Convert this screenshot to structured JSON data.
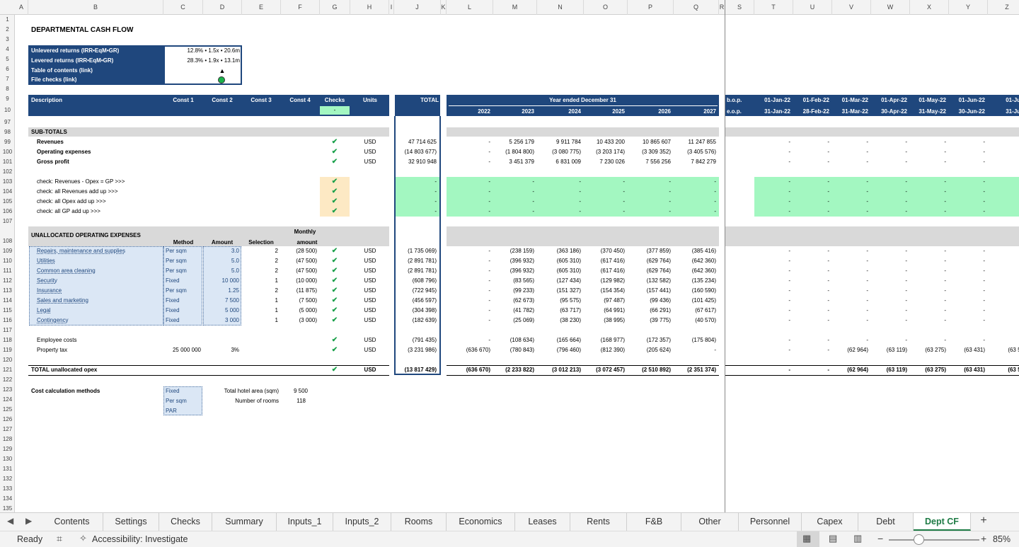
{
  "sheet_title": "DEPARTMENTAL CASH FLOW",
  "columns": [
    "A",
    "B",
    "C",
    "D",
    "E",
    "F",
    "G",
    "H",
    "I",
    "J",
    "K",
    "L",
    "M",
    "N",
    "O",
    "P",
    "Q",
    "R",
    "S",
    "T",
    "U",
    "V",
    "W",
    "X",
    "Y",
    "Z"
  ],
  "row_numbers": [
    "1",
    "2",
    "3",
    "4",
    "5",
    "6",
    "7",
    "8",
    "9",
    "10",
    "97",
    "98",
    "99",
    "100",
    "101",
    "102",
    "103",
    "104",
    "105",
    "106",
    "107",
    "108",
    "109",
    "110",
    "111",
    "112",
    "113",
    "114",
    "115",
    "116",
    "117",
    "118",
    "119",
    "120",
    "121",
    "122",
    "123",
    "124",
    "125",
    "126",
    "127",
    "128",
    "129",
    "130",
    "131",
    "132",
    "133",
    "134",
    "135"
  ],
  "summary_box": {
    "rows": [
      {
        "label": "Unlevered returns (IRR•EqM•GR)",
        "value": "12.8% • 1.5x • 20.6m"
      },
      {
        "label": "Levered returns (IRR•EqM•GR)",
        "value": "28.3% • 1.9x • 13.1m"
      },
      {
        "label": "Table of contents (link)",
        "value": "▲"
      },
      {
        "label": "File checks (link)",
        "value": ""
      }
    ],
    "status_color": "#1bb24b"
  },
  "header": {
    "description": "Description",
    "const1": "Const 1",
    "const2": "Const 2",
    "const3": "Const 3",
    "const4": "Const 4",
    "checks": "Checks",
    "checks_value": "-",
    "units": "Units",
    "total": "TOTAL",
    "year_title": "Year ended December 31",
    "years": [
      "2022",
      "2023",
      "2024",
      "2025",
      "2026",
      "2027"
    ],
    "bop": "b.o.p.",
    "eop": "e.o.p.",
    "month_starts": [
      "01-Jan-22",
      "01-Feb-22",
      "01-Mar-22",
      "01-Apr-22",
      "01-May-22",
      "01-Jun-22",
      "01-Jul-"
    ],
    "month_ends": [
      "31-Jan-22",
      "28-Feb-22",
      "31-Mar-22",
      "30-Apr-22",
      "31-May-22",
      "30-Jun-22",
      "31-Jul-"
    ]
  },
  "subtotals": {
    "title": "SUB-TOTALS",
    "rows": [
      {
        "label": "Revenues",
        "check": "✔",
        "unit": "USD",
        "total": "47 714 625",
        "years": [
          "-",
          "5 256 179",
          "9 911 784",
          "10 433 200",
          "10 865 607",
          "11 247 855"
        ],
        "months": [
          "-",
          "-",
          "-",
          "-",
          "-",
          "-"
        ]
      },
      {
        "label": "Operating expenses",
        "check": "✔",
        "unit": "USD",
        "total": "(14 803 677)",
        "years": [
          "-",
          "(1 804 800)",
          "(3 080 775)",
          "(3 203 174)",
          "(3 309 352)",
          "(3 405 576)"
        ],
        "months": [
          "-",
          "-",
          "-",
          "-",
          "-",
          "-"
        ]
      },
      {
        "label": "Gross profit",
        "check": "✔",
        "unit": "USD",
        "total": "32 910 948",
        "years": [
          "-",
          "3 451 379",
          "6 831 009",
          "7 230 026",
          "7 556 256",
          "7 842 279"
        ],
        "months": [
          "-",
          "-",
          "-",
          "-",
          "-",
          "-"
        ]
      }
    ]
  },
  "checks_rows": [
    {
      "label": "check: Revenues - Opex = GP >>>",
      "check": "✔"
    },
    {
      "label": "check: all Revenues add up >>>",
      "check": "✔"
    },
    {
      "label": "check: all Opex add up >>>",
      "check": "✔"
    },
    {
      "label": "check: all GP add up >>>",
      "check": "✔"
    }
  ],
  "checks_dash": "-",
  "unallocated": {
    "title": "UNALLOCATED OPERATING EXPENSES",
    "method_h": "Method",
    "amount_h": "Amount",
    "selection_h": "Selection",
    "monthly_h1": "Monthly",
    "monthly_h2": "amount",
    "rows": [
      {
        "label": "Repairs, maintenance and supplies",
        "method": "Per sqm",
        "amount": "3.0",
        "selection": "2",
        "monthly": "(28 500)",
        "check": "✔",
        "unit": "USD",
        "total": "(1 735 069)",
        "years": [
          "-",
          "(238 159)",
          "(363 186)",
          "(370 450)",
          "(377 859)",
          "(385 416)"
        ],
        "months": [
          "-",
          "-",
          "-",
          "-",
          "-",
          "-"
        ]
      },
      {
        "label": "Utilities",
        "method": "Per sqm",
        "amount": "5.0",
        "selection": "2",
        "monthly": "(47 500)",
        "check": "✔",
        "unit": "USD",
        "total": "(2 891 781)",
        "years": [
          "-",
          "(396 932)",
          "(605 310)",
          "(617 416)",
          "(629 764)",
          "(642 360)"
        ],
        "months": [
          "-",
          "-",
          "-",
          "-",
          "-",
          "-"
        ]
      },
      {
        "label": "Common area cleaning",
        "method": "Per sqm",
        "amount": "5.0",
        "selection": "2",
        "monthly": "(47 500)",
        "check": "✔",
        "unit": "USD",
        "total": "(2 891 781)",
        "years": [
          "-",
          "(396 932)",
          "(605 310)",
          "(617 416)",
          "(629 764)",
          "(642 360)"
        ],
        "months": [
          "-",
          "-",
          "-",
          "-",
          "-",
          "-"
        ]
      },
      {
        "label": "Security",
        "method": "Fixed",
        "amount": "10 000",
        "selection": "1",
        "monthly": "(10 000)",
        "check": "✔",
        "unit": "USD",
        "total": "(608 796)",
        "years": [
          "-",
          "(83 565)",
          "(127 434)",
          "(129 982)",
          "(132 582)",
          "(135 234)"
        ],
        "months": [
          "-",
          "-",
          "-",
          "-",
          "-",
          "-"
        ]
      },
      {
        "label": "Insurance",
        "method": "Per sqm",
        "amount": "1.25",
        "selection": "2",
        "monthly": "(11 875)",
        "check": "✔",
        "unit": "USD",
        "total": "(722 945)",
        "years": [
          "-",
          "(99 233)",
          "(151 327)",
          "(154 354)",
          "(157 441)",
          "(160 590)"
        ],
        "months": [
          "-",
          "-",
          "-",
          "-",
          "-",
          "-"
        ]
      },
      {
        "label": "Sales and marketing",
        "method": "Fixed",
        "amount": "7 500",
        "selection": "1",
        "monthly": "(7 500)",
        "check": "✔",
        "unit": "USD",
        "total": "(456 597)",
        "years": [
          "-",
          "(62 673)",
          "(95 575)",
          "(97 487)",
          "(99 436)",
          "(101 425)"
        ],
        "months": [
          "-",
          "-",
          "-",
          "-",
          "-",
          "-"
        ]
      },
      {
        "label": "Legal",
        "method": "Fixed",
        "amount": "5 000",
        "selection": "1",
        "monthly": "(5 000)",
        "check": "✔",
        "unit": "USD",
        "total": "(304 398)",
        "years": [
          "-",
          "(41 782)",
          "(63 717)",
          "(64 991)",
          "(66 291)",
          "(67 617)"
        ],
        "months": [
          "-",
          "-",
          "-",
          "-",
          "-",
          "-"
        ]
      },
      {
        "label": "Contingency",
        "method": "Fixed",
        "amount": "3 000",
        "selection": "1",
        "monthly": "(3 000)",
        "check": "✔",
        "unit": "USD",
        "total": "(182 639)",
        "years": [
          "-",
          "(25 069)",
          "(38 230)",
          "(38 995)",
          "(39 775)",
          "(40 570)"
        ],
        "months": [
          "-",
          "-",
          "-",
          "-",
          "-",
          "-"
        ]
      }
    ],
    "employee": {
      "label": "Employee costs",
      "check": "✔",
      "unit": "USD",
      "total": "(791 435)",
      "years": [
        "-",
        "(108 634)",
        "(165 664)",
        "(168 977)",
        "(172 357)",
        "(175 804)"
      ],
      "months": [
        "-",
        "-",
        "-",
        "-",
        "-",
        "-"
      ]
    },
    "property": {
      "label": "Property tax",
      "const1": "25 000 000",
      "const2": "3%",
      "check": "✔",
      "unit": "USD",
      "total": "(3 231 986)",
      "years": [
        "(636 670)",
        "(780 843)",
        "(796 460)",
        "(812 390)",
        "(205 624)",
        "-"
      ],
      "months": [
        "-",
        "-",
        "(62 964)",
        "(63 119)",
        "(63 275)",
        "(63 431)",
        "(63 58"
      ]
    },
    "total": {
      "label": "TOTAL unallocated opex",
      "check": "✔",
      "unit": "USD",
      "total": "(13 817 429)",
      "years": [
        "(636 670)",
        "(2 233 822)",
        "(3 012 213)",
        "(3 072 457)",
        "(2 510 892)",
        "(2 351 374)"
      ],
      "months": [
        "-",
        "-",
        "(62 964)",
        "(63 119)",
        "(63 275)",
        "(63 431)",
        "(63 58"
      ]
    }
  },
  "cost_methods": {
    "title": "Cost calculation methods",
    "methods": [
      "Fixed",
      "Per sqm",
      "PAR"
    ],
    "area_label": "Total hotel area (sqm)",
    "area_value": "9 500",
    "rooms_label": "Number of rooms",
    "rooms_value": "118"
  },
  "tabs": [
    "Contents",
    "Settings",
    "Checks",
    "Summary",
    "Inputs_1",
    "Inputs_2",
    "Rooms",
    "Economics",
    "Leases",
    "Rents",
    "F&B",
    "Other",
    "Personnel",
    "Capex",
    "Debt",
    "Dept CF"
  ],
  "active_tab": "Dept CF",
  "add_tab": "+",
  "status": {
    "ready": "Ready",
    "accessibility": "Accessibility: Investigate",
    "zoom": "85%"
  }
}
